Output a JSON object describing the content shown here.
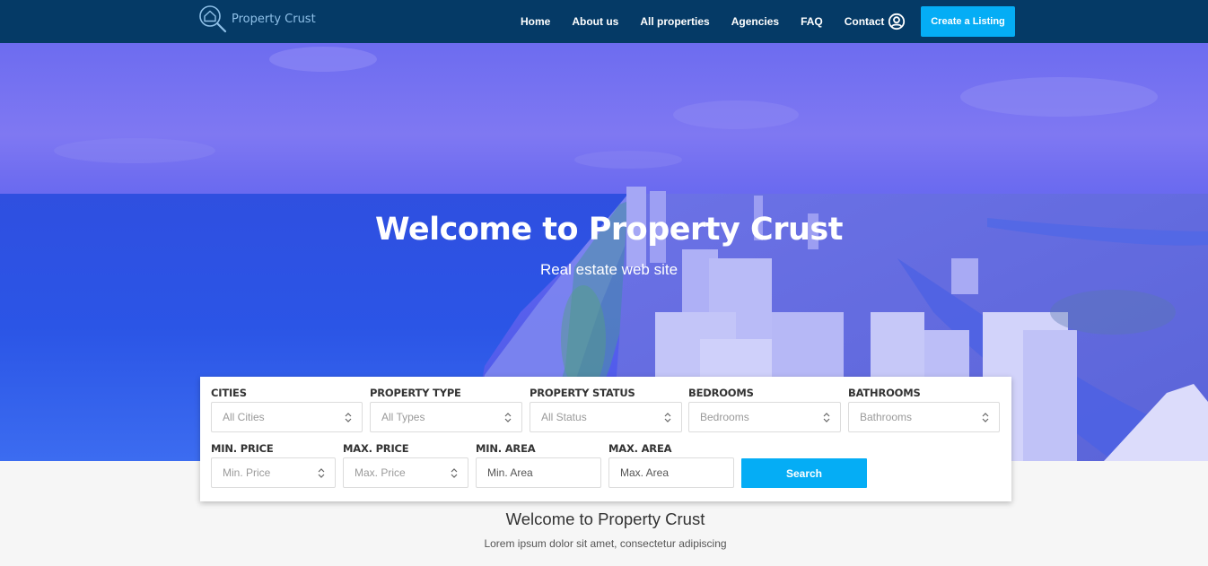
{
  "brand": {
    "name": "Property Crust",
    "logo_icon": "house-magnifier-icon"
  },
  "nav": {
    "items": [
      "Home",
      "About us",
      "All properties",
      "Agencies",
      "FAQ",
      "Contact"
    ],
    "user_icon": "user-circle-icon",
    "cta_label": "Create a Listing"
  },
  "hero": {
    "title": "Welcome to Property Crust",
    "subtitle": "Real estate web site"
  },
  "search": {
    "cities": {
      "label": "CITIES",
      "value": "All Cities"
    },
    "property_type": {
      "label": "PROPERTY TYPE",
      "value": "All Types"
    },
    "property_status": {
      "label": "PROPERTY STATUS",
      "value": "All Status"
    },
    "bedrooms": {
      "label": "BEDROOMS",
      "value": "Bedrooms"
    },
    "bathrooms": {
      "label": "BATHROOMS",
      "value": "Bathrooms"
    },
    "min_price": {
      "label": "MIN. PRICE",
      "value": "Min. Price"
    },
    "max_price": {
      "label": "MAX. PRICE",
      "value": "Max. Price"
    },
    "min_area": {
      "label": "MIN. AREA",
      "placeholder": "Min. Area"
    },
    "max_area": {
      "label": "MAX. AREA",
      "placeholder": "Max. Area"
    },
    "button_label": "Search"
  },
  "intro": {
    "title": "Welcome to Property Crust",
    "text": "Lorem ipsum dolor sit amet, consectetur adipiscing"
  },
  "colors": {
    "navbar": "#053a66",
    "accent": "#05adf5",
    "hero_overlay": "#6467ee"
  }
}
